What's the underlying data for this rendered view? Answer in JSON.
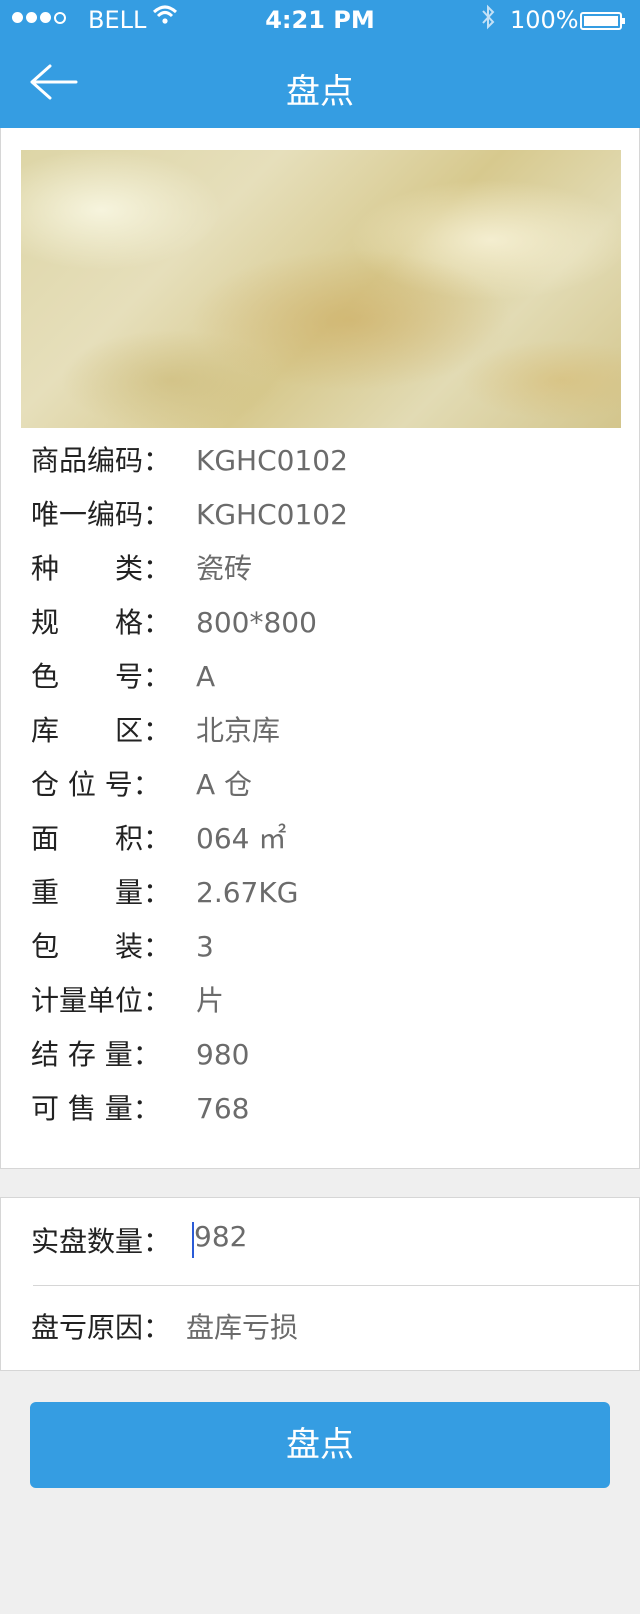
{
  "status_bar": {
    "carrier": "BELL",
    "time": "4:21 PM",
    "battery": "100%"
  },
  "nav": {
    "title": "盘点",
    "back_icon": "arrow-left-icon"
  },
  "product": {
    "image_icon": "tile-photo",
    "fields": [
      {
        "label": "商品编码：",
        "value": "KGHC0102"
      },
      {
        "label": "唯一编码：",
        "value": "KGHC0102"
      },
      {
        "label": "种　　类：",
        "value": "瓷砖"
      },
      {
        "label": "规　　格：",
        "value": "800*800"
      },
      {
        "label": "色　　号：",
        "value": "A"
      },
      {
        "label": "库　　区：",
        "value": "北京库"
      },
      {
        "label": "仓 位 号：",
        "value": " A 仓"
      },
      {
        "label": "面　　积：",
        "value": "064 ㎡"
      },
      {
        "label": "重　　量：",
        "value": "2.67KG"
      },
      {
        "label": "包　　装：",
        "value": "3"
      },
      {
        "label": "计量单位：",
        "value": "片"
      },
      {
        "label": "结 存 量：",
        "value": "980"
      },
      {
        "label": "可 售 量：",
        "value": "768"
      }
    ]
  },
  "form": {
    "count_label": "实盘数量：",
    "count_value": "982",
    "reason_label": "盘亏原因：",
    "reason_value": "盘库亏损"
  },
  "submit_label": "盘点",
  "colors": {
    "primary": "#359de2",
    "background": "#efefef"
  }
}
